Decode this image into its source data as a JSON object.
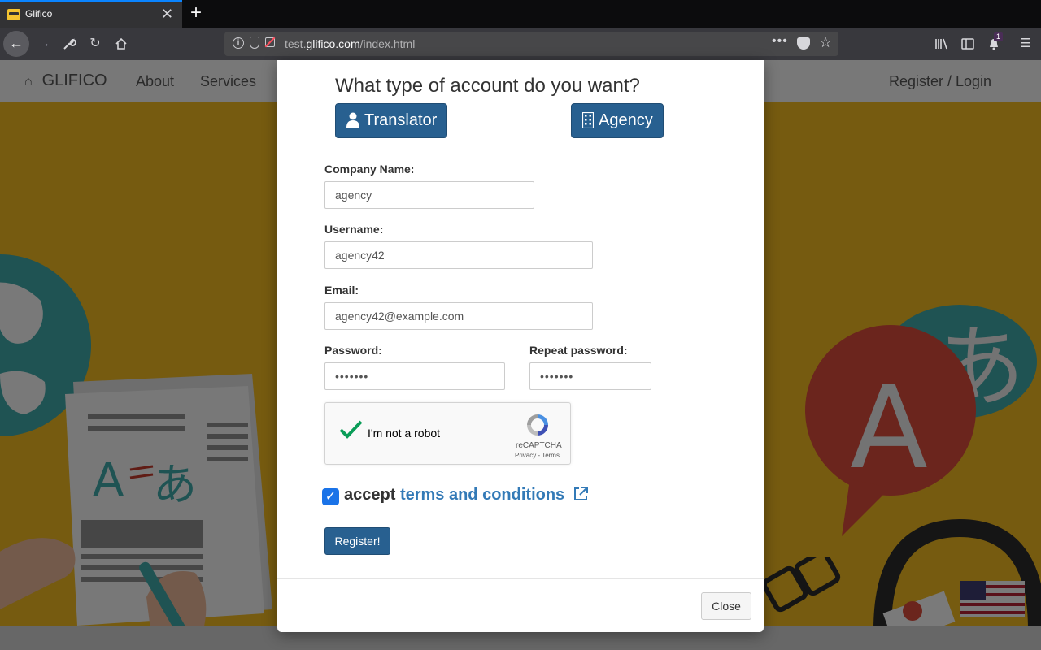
{
  "browser": {
    "tab_title": "Glifico",
    "tab_close": "✕",
    "new_tab": "+",
    "url_prefix": "test.",
    "url_domain": "glifico.com",
    "url_path": "/index.html",
    "url_more": "•••",
    "notification_count": "1"
  },
  "site": {
    "brand": "GLIFICO",
    "nav_about": "About",
    "nav_services": "Services",
    "nav_login": "Register / Login"
  },
  "illustration": {
    "swap_left": "A",
    "swap_right": "あ",
    "bubble_red": "A",
    "bubble_teal": "あ"
  },
  "modal": {
    "heading": "What type of account do you want?",
    "translator_label": "Translator",
    "agency_label": "Agency",
    "company_label": "Company Name:",
    "company_value": "agency",
    "username_label": "Username:",
    "username_value": "agency42",
    "email_label": "Email:",
    "email_value": "agency42@example.com",
    "password_label": "Password:",
    "password_value": "•••••••",
    "repeat_label": "Repeat password:",
    "repeat_value": "•••••••",
    "captcha_text": "I'm not a robot",
    "captcha_brand": "reCAPTCHA",
    "captcha_links": "Privacy - Terms",
    "accept_word": "accept",
    "terms_link": "terms and conditions",
    "register_label": "Register!",
    "close_label": "Close",
    "accept_checked": true
  },
  "colors": {
    "primary": "#286090",
    "link": "#337ab7",
    "hero_yellow": "#edb620",
    "checkbox_blue": "#1a73e8",
    "captcha_green": "#0a9d58"
  }
}
